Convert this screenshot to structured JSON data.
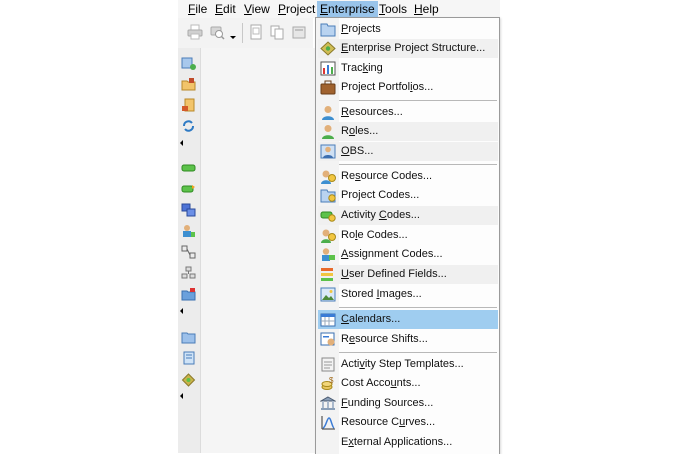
{
  "menubar": {
    "items": [
      {
        "label": "File",
        "mnemonic": "F",
        "rest": "ile"
      },
      {
        "label": "Edit",
        "mnemonic": "E",
        "rest": "dit"
      },
      {
        "label": "View",
        "mnemonic": "V",
        "rest": "iew"
      },
      {
        "label": "Project",
        "mnemonic": "P",
        "rest": "roject"
      },
      {
        "label": "Enterprise",
        "mnemonic": "E",
        "rest": "nterprise",
        "active": true
      },
      {
        "label": "Tools",
        "mnemonic": "T",
        "rest": "ools"
      },
      {
        "label": "Help",
        "mnemonic": "H",
        "rest": "elp"
      }
    ]
  },
  "toolbar": {
    "icons": [
      "print-icon",
      "print-preview-icon",
      "page-setup-icon",
      "copy-icon",
      "cut-icon",
      "paste-icon"
    ]
  },
  "side_toolbar": {
    "icons": [
      "add-project-icon",
      "open-folder-icon",
      "assign-icon",
      "refresh-icon",
      "activity-bar-icon",
      "activity-link-icon",
      "relationships-icon",
      "resource-assign-icon",
      "network-icon",
      "wbs-icon",
      "folder-flag-icon",
      "folder-icon",
      "notebook-icon",
      "eps-icon"
    ]
  },
  "enterprise_menu": {
    "groups": [
      [
        {
          "id": "projects",
          "pre": "",
          "mn": "P",
          "post": "rojects",
          "icon": "projects-icon"
        },
        {
          "id": "eps",
          "pre": "",
          "mn": "E",
          "post": "nterprise Project Structure...",
          "icon": "eps-icon"
        },
        {
          "id": "tracking",
          "pre": "Trac",
          "mn": "k",
          "post": "ing",
          "icon": "tracking-icon"
        },
        {
          "id": "portfolios",
          "pre": "Project Portfol",
          "mn": "i",
          "post": "os...",
          "icon": "portfolio-icon"
        }
      ],
      [
        {
          "id": "resources",
          "pre": "",
          "mn": "R",
          "post": "esources...",
          "icon": "resources-icon"
        },
        {
          "id": "roles",
          "pre": "R",
          "mn": "o",
          "post": "les...",
          "icon": "roles-icon"
        },
        {
          "id": "obs",
          "pre": "",
          "mn": "O",
          "post": "BS...",
          "icon": "obs-icon"
        }
      ],
      [
        {
          "id": "resource_codes",
          "pre": "Re",
          "mn": "s",
          "post": "ource Codes...",
          "icon": "resource-codes-icon"
        },
        {
          "id": "project_codes",
          "pre": "Pro",
          "mn": "j",
          "post": "ect Codes...",
          "icon": "project-codes-icon"
        },
        {
          "id": "activity_codes",
          "pre": "Activity ",
          "mn": "C",
          "post": "odes...",
          "icon": "activity-codes-icon"
        },
        {
          "id": "role_codes",
          "pre": "Ro",
          "mn": "l",
          "post": "e Codes...",
          "icon": "role-codes-icon"
        },
        {
          "id": "assignment_codes",
          "pre": "",
          "mn": "A",
          "post": "ssignment Codes...",
          "icon": "assignment-codes-icon"
        },
        {
          "id": "udf",
          "pre": "",
          "mn": "U",
          "post": "ser Defined Fields...",
          "icon": "udf-icon"
        },
        {
          "id": "stored_images",
          "pre": "Stored ",
          "mn": "I",
          "post": "mages...",
          "icon": "stored-images-icon"
        }
      ],
      [
        {
          "id": "calendars",
          "pre": "",
          "mn": "C",
          "post": "alendars...",
          "icon": "calendar-icon",
          "highlighted": true
        },
        {
          "id": "resource_shifts",
          "pre": "R",
          "mn": "e",
          "post": "source Shifts...",
          "icon": "resource-shifts-icon"
        }
      ],
      [
        {
          "id": "step_templates",
          "pre": "Acti",
          "mn": "v",
          "post": "ity Step Templates...",
          "icon": "step-templates-icon"
        },
        {
          "id": "cost_accounts",
          "pre": "Cost Acco",
          "mn": "u",
          "post": "nts...",
          "icon": "cost-accounts-icon"
        },
        {
          "id": "funding",
          "pre": "",
          "mn": "F",
          "post": "unding Sources...",
          "icon": "funding-icon"
        },
        {
          "id": "resource_curves",
          "pre": "Resource C",
          "mn": "u",
          "post": "rves...",
          "icon": "resource-curves-icon"
        },
        {
          "id": "external_apps",
          "pre": "E",
          "mn": "x",
          "post": "ternal Applications...",
          "icon": ""
        }
      ]
    ]
  }
}
